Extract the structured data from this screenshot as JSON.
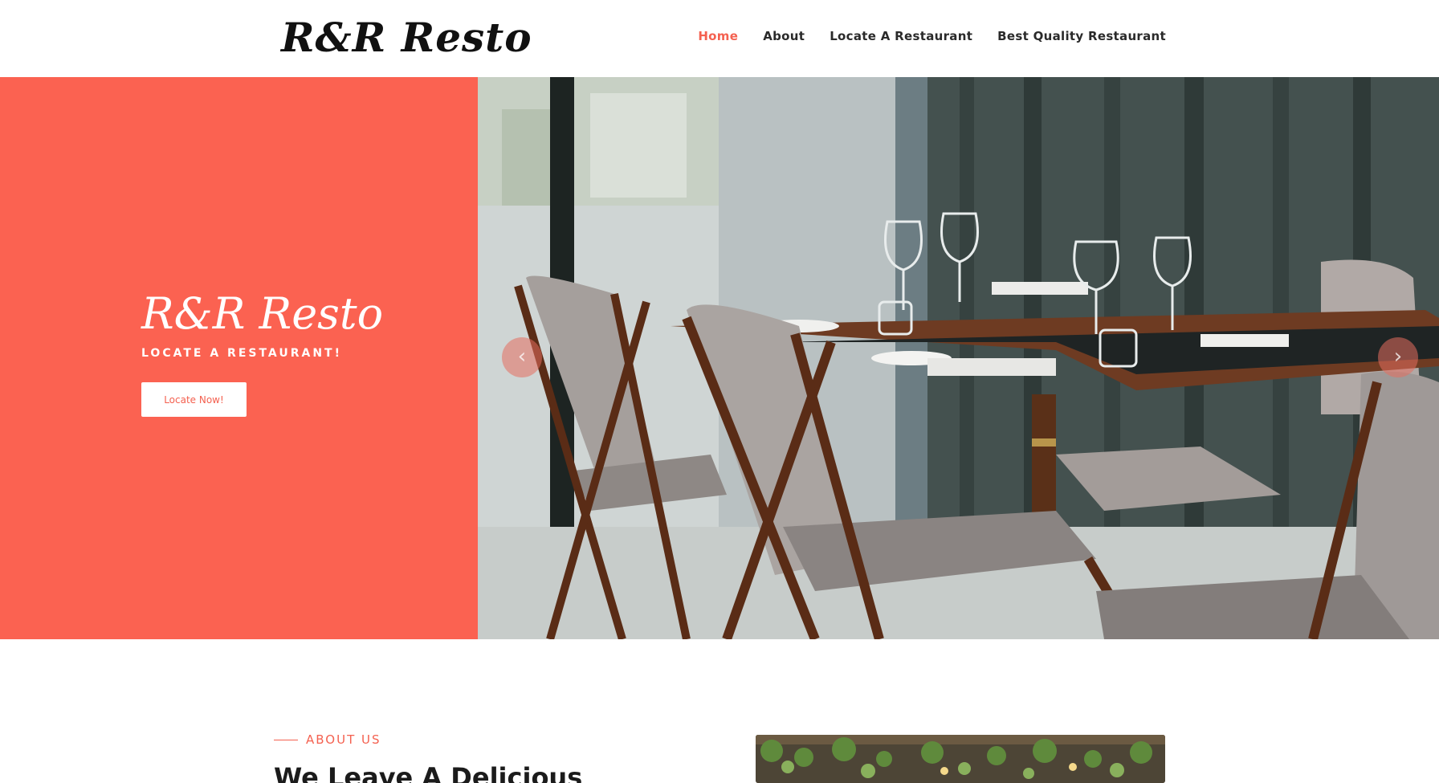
{
  "header": {
    "logo": "R&R Resto",
    "nav": [
      {
        "label": "Home",
        "active": true
      },
      {
        "label": "About",
        "active": false
      },
      {
        "label": "Locate A Restaurant",
        "active": false
      },
      {
        "label": "Best Quality Restaurant",
        "active": false
      }
    ]
  },
  "hero": {
    "title": "R&R Resto",
    "subtitle": "LOCATE A RESTAURANT!",
    "button_label": "Locate Now!",
    "prev_arrow": "‹",
    "next_arrow": "›",
    "image_icon": "restaurant-interior-photo"
  },
  "about": {
    "label": "ABOUT US",
    "heading": "We Leave A Delicious"
  },
  "colors": {
    "accent": "#f46150",
    "hero_panel": "#fb6251",
    "text_dark": "#1b1b1b"
  }
}
